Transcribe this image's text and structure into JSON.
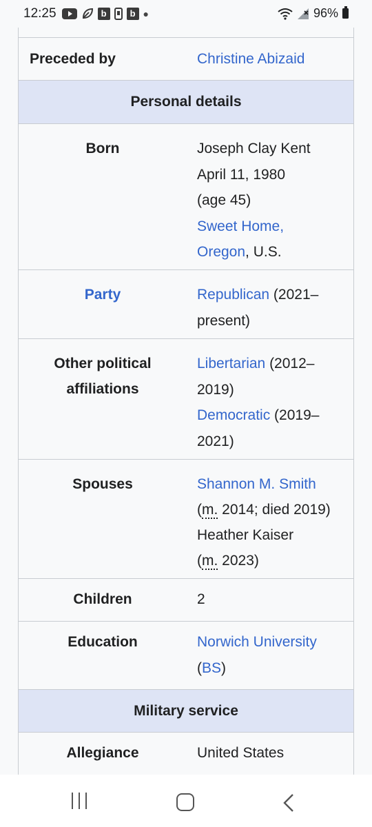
{
  "status_bar": {
    "time": "12:25",
    "battery": "96%",
    "badge": "b"
  },
  "infobox": {
    "preceded_by": {
      "label": "Preceded by",
      "value": "Christine Abizaid"
    },
    "personal_details": "Personal details",
    "born": {
      "label": "Born",
      "name": "Joseph Clay Kent",
      "date": "April 11, 1980",
      "age": "(age 45)",
      "place_link_1": "Sweet Home,",
      "place_link_2": "Oregon",
      "place_suffix": ", U.S."
    },
    "party": {
      "label": "Party",
      "link": "Republican",
      "years_1": " (2021–",
      "years_2": "present)"
    },
    "other_affiliations": {
      "label_1": "Other political",
      "label_2": "affiliations",
      "link_1": "Libertarian",
      "years_1a": " (2012–",
      "years_1b": "2019)",
      "link_2": "Democratic",
      "years_2a": " (2019–",
      "years_2b": "2021)"
    },
    "spouses": {
      "label": "Spouses",
      "spouse_1": "Shannon M. Smith",
      "married_abbr": "m.",
      "spouse_1_detail_pre": "(",
      "spouse_1_detail": " 2014; died 2019)",
      "spouse_2": "Heather Kaiser",
      "spouse_2_detail_pre": "(",
      "spouse_2_detail": " 2023)"
    },
    "children": {
      "label": "Children",
      "value": "2"
    },
    "education": {
      "label": "Education",
      "link": "Norwich University",
      "degree_pre": "(",
      "degree_link": "BS",
      "degree_post": ")"
    },
    "military_service": "Military service",
    "allegiance": {
      "label": "Allegiance",
      "value": "United States"
    }
  }
}
